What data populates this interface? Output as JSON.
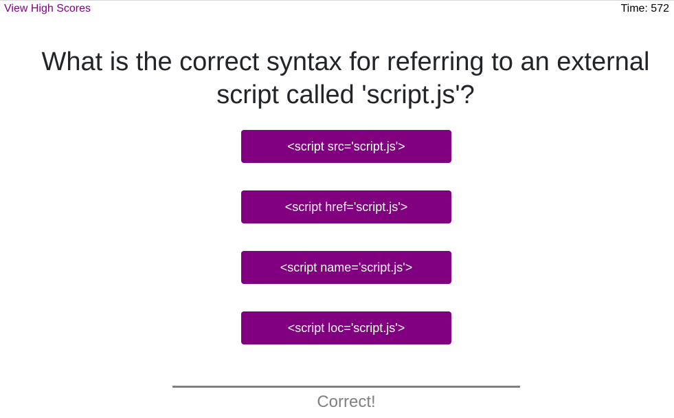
{
  "header": {
    "high_scores_label": "View High Scores",
    "timer_label": "Time: 572"
  },
  "quiz": {
    "question": "What is the correct syntax for referring to an external script called 'script.js'?",
    "answers": [
      "<script src='script.js'>",
      "<script href='script.js'>",
      "<script name='script.js'>",
      "<script loc='script.js'>"
    ],
    "feedback": "Correct!"
  },
  "colors": {
    "accent": "#800080",
    "feedback_gray": "#808080"
  }
}
